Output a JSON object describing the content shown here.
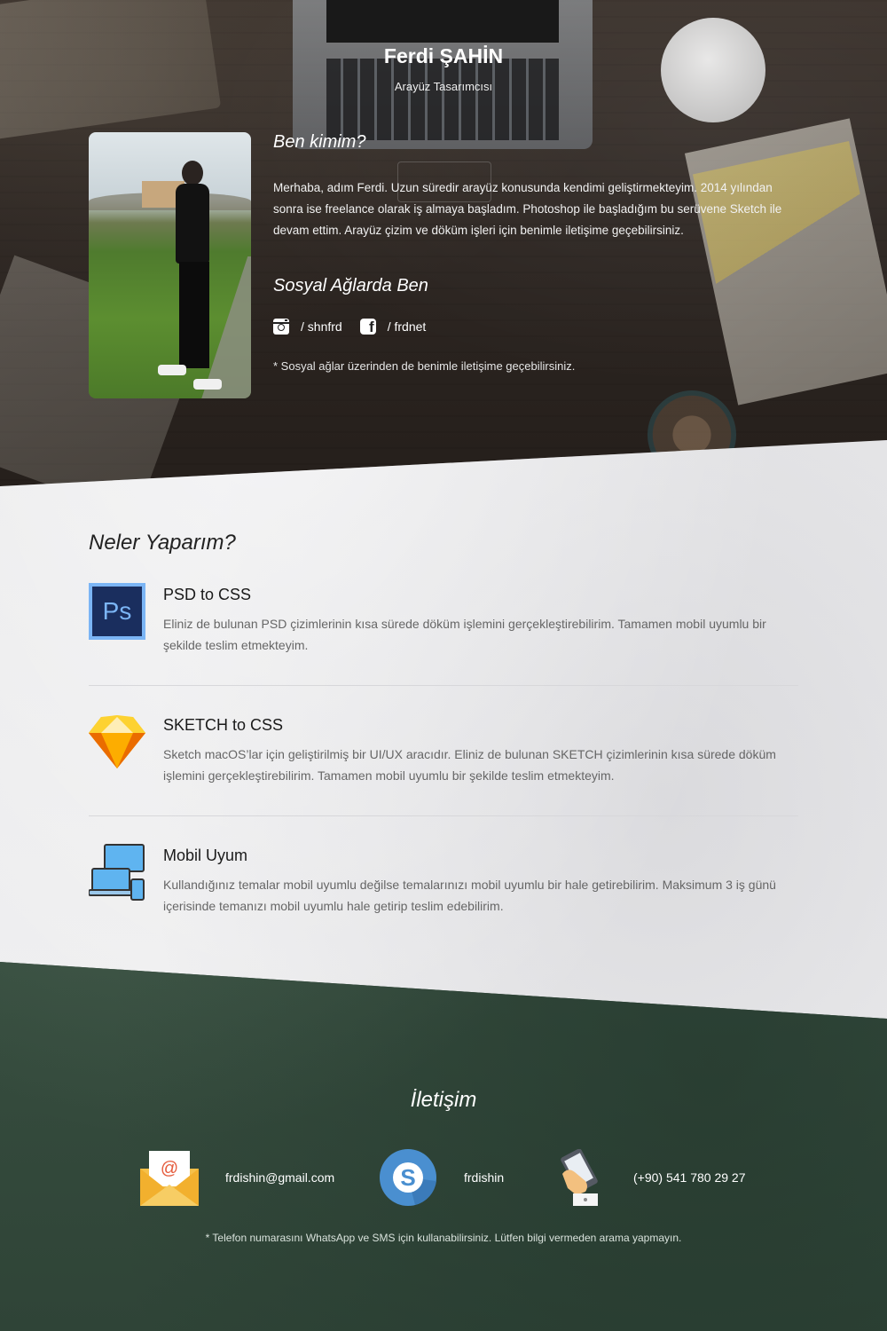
{
  "profile": {
    "name": "Ferdi ŞAHİN",
    "role": "Arayüz Tasarımcısı"
  },
  "about": {
    "title": "Ben kimim?",
    "text": "Merhaba, adım Ferdi. Uzun süredir arayüz konusunda kendimi geliştirmekteyim. 2014 yılından sonra ise freelance olarak iş almaya başladım. Photoshop ile başladığım bu serüvene Sketch ile devam ettim. Arayüz çizim ve döküm işleri için benimle iletişime geçebilirsiniz."
  },
  "social": {
    "title": "Sosyal Ağlarda Ben",
    "links": [
      {
        "icon": "instagram-icon",
        "label": "/ shnfrd"
      },
      {
        "icon": "facebook-icon",
        "label": "/ frdnet"
      }
    ],
    "note": "* Sosyal ağlar üzerinden de benimle iletişime geçebilirsiniz."
  },
  "services": {
    "title": "Neler Yaparım?",
    "items": [
      {
        "icon": "photoshop-icon",
        "icon_text": "Ps",
        "name": "PSD to CSS",
        "desc": "Eliniz de bulunan PSD çizimlerinin kısa sürede döküm işlemini gerçekleştirebilirim. Tamamen mobil uyumlu bir şekilde teslim etmekteyim."
      },
      {
        "icon": "sketch-icon",
        "name": "SKETCH to CSS",
        "desc": "Sketch macOS’lar için geliştirilmiş bir UI/UX aracıdır. Eliniz de bulunan SKETCH çizimlerinin kısa sürede döküm işlemini gerçekleştirebilirim. Tamamen mobil uyumlu bir şekilde teslim etmekteyim."
      },
      {
        "icon": "responsive-devices-icon",
        "name": "Mobil Uyum",
        "desc": "Kullandığınız temalar mobil uyumlu değilse temalarınızı mobil uyumlu bir hale getirebilirim. Maksimum 3 iş günü içerisinde temanızı mobil uyumlu hale getirip teslim edebilirim."
      }
    ]
  },
  "contact": {
    "title": "İletişim",
    "items": [
      {
        "icon": "email-envelope-icon",
        "label": "frdishin@gmail.com"
      },
      {
        "icon": "skype-icon",
        "label": "frdishin"
      },
      {
        "icon": "phone-hand-icon",
        "label": "(+90) 541 780 29 27"
      }
    ],
    "note": "* Telefon numarasını WhatsApp ve SMS için kullanabilirsiniz. Lütfen bilgi vermeden arama yapmayın."
  },
  "colors": {
    "hero_bg": "#2d2622",
    "services_bg": "#ececee",
    "contact_bg": "#3d5546",
    "photoshop_blue": "#7bb5f5",
    "sketch_yellow": "#fdb300",
    "skype_blue": "#4a8fd0",
    "envelope_yellow": "#f5c04a"
  }
}
